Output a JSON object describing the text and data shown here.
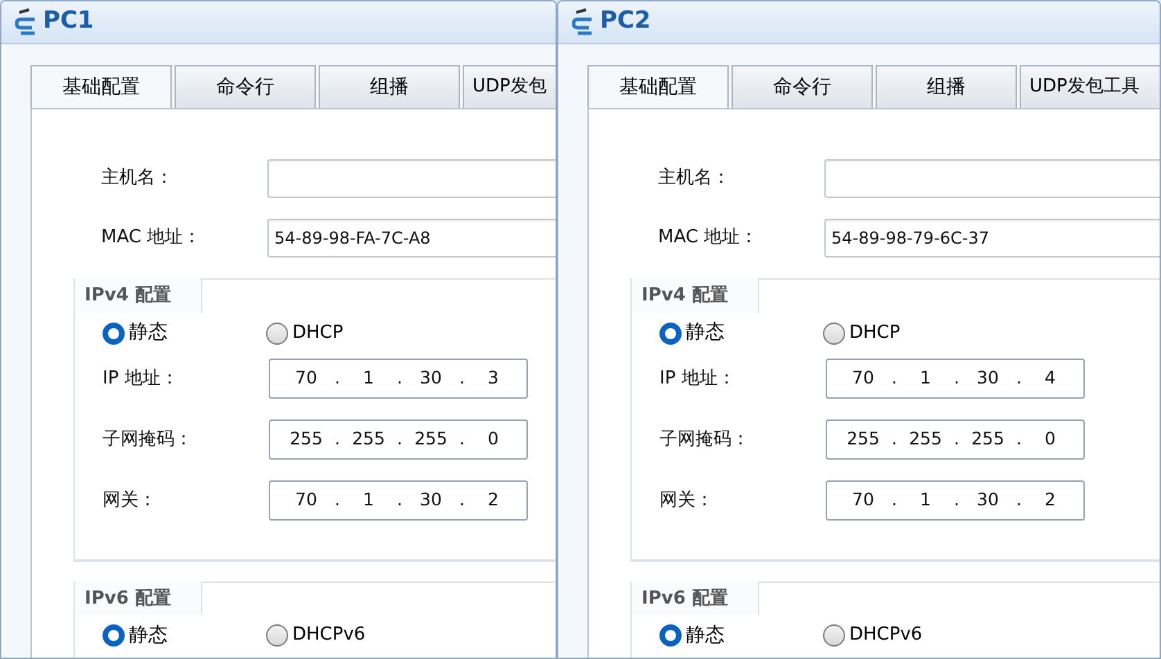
{
  "windows": [
    {
      "title": "PC1",
      "tabs": [
        {
          "label": "基础配置",
          "selected": true
        },
        {
          "label": "命令行",
          "selected": false
        },
        {
          "label": "组播",
          "selected": false
        },
        {
          "label": "UDP发包",
          "selected": false
        }
      ],
      "hostname": {
        "label": "主机名："
      },
      "mac": {
        "label": "MAC 地址：",
        "value": "54-89-98-FA-7C-A8"
      },
      "ipv4": {
        "title": "IPv4 配置",
        "modes": [
          {
            "label": "静态",
            "selected": true
          },
          {
            "label": "DHCP",
            "selected": false
          }
        ],
        "separator": ".",
        "fields": [
          {
            "label": "IP 地址：",
            "octets": [
              "70",
              "1",
              "30",
              "3"
            ]
          },
          {
            "label": "子网掩码：",
            "octets": [
              "255",
              "255",
              "255",
              "0"
            ]
          },
          {
            "label": "网关：",
            "octets": [
              "70",
              "1",
              "30",
              "2"
            ]
          }
        ]
      },
      "ipv6": {
        "title": "IPv6 配置",
        "modes": [
          {
            "label": "静态",
            "selected": true
          },
          {
            "label": "DHCPv6",
            "selected": false
          }
        ]
      }
    },
    {
      "title": "PC2",
      "tabs": [
        {
          "label": "基础配置",
          "selected": true
        },
        {
          "label": "命令行",
          "selected": false
        },
        {
          "label": "组播",
          "selected": false
        },
        {
          "label": "UDP发包工具",
          "selected": false
        }
      ],
      "hostname": {
        "label": "主机名："
      },
      "mac": {
        "label": "MAC 地址：",
        "value": "54-89-98-79-6C-37"
      },
      "ipv4": {
        "title": "IPv4 配置",
        "modes": [
          {
            "label": "静态",
            "selected": true
          },
          {
            "label": "DHCP",
            "selected": false
          }
        ],
        "separator": ".",
        "fields": [
          {
            "label": "IP 地址：",
            "octets": [
              "70",
              "1",
              "30",
              "4"
            ]
          },
          {
            "label": "子网掩码：",
            "octets": [
              "255",
              "255",
              "255",
              "0"
            ]
          },
          {
            "label": "网关：",
            "octets": [
              "70",
              "1",
              "30",
              "2"
            ]
          }
        ]
      },
      "ipv6": {
        "title": "IPv6 配置",
        "modes": [
          {
            "label": "静态",
            "selected": true
          },
          {
            "label": "DHCPv6",
            "selected": false
          }
        ]
      }
    }
  ]
}
